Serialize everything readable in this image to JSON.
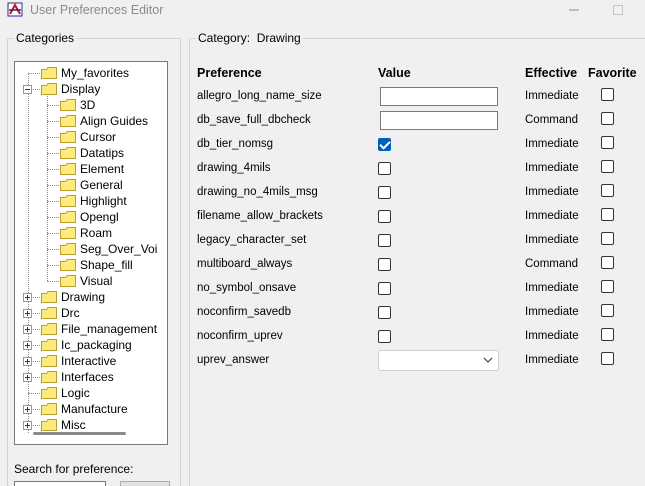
{
  "window": {
    "title": "User Preferences Editor"
  },
  "categories_panel": {
    "legend": "Categories",
    "tree": [
      {
        "label": "My_favorites",
        "depth": 0,
        "expander": "none"
      },
      {
        "label": "Display",
        "depth": 0,
        "expander": "minus"
      },
      {
        "label": "3D",
        "depth": 1,
        "expander": "none"
      },
      {
        "label": "Align Guides",
        "depth": 1,
        "expander": "none"
      },
      {
        "label": "Cursor",
        "depth": 1,
        "expander": "none"
      },
      {
        "label": "Datatips",
        "depth": 1,
        "expander": "none"
      },
      {
        "label": "Element",
        "depth": 1,
        "expander": "none"
      },
      {
        "label": "General",
        "depth": 1,
        "expander": "none"
      },
      {
        "label": "Highlight",
        "depth": 1,
        "expander": "none"
      },
      {
        "label": "Opengl",
        "depth": 1,
        "expander": "none"
      },
      {
        "label": "Roam",
        "depth": 1,
        "expander": "none"
      },
      {
        "label": "Seg_Over_Voi",
        "depth": 1,
        "expander": "none"
      },
      {
        "label": "Shape_fill",
        "depth": 1,
        "expander": "none"
      },
      {
        "label": "Visual",
        "depth": 1,
        "expander": "none"
      },
      {
        "label": "Drawing",
        "depth": 0,
        "expander": "plus"
      },
      {
        "label": "Drc",
        "depth": 0,
        "expander": "plus"
      },
      {
        "label": "File_management",
        "depth": 0,
        "expander": "plus"
      },
      {
        "label": "Ic_packaging",
        "depth": 0,
        "expander": "plus"
      },
      {
        "label": "Interactive",
        "depth": 0,
        "expander": "plus"
      },
      {
        "label": "Interfaces",
        "depth": 0,
        "expander": "plus"
      },
      {
        "label": "Logic",
        "depth": 0,
        "expander": "none"
      },
      {
        "label": "Manufacture",
        "depth": 0,
        "expander": "plus"
      },
      {
        "label": "Misc",
        "depth": 0,
        "expander": "plus"
      }
    ],
    "search_label": "Search for preference:"
  },
  "category_panel": {
    "legend_label": "Category:",
    "legend_value": "Drawing",
    "headers": {
      "preference": "Preference",
      "value": "Value",
      "effective": "Effective",
      "favorite": "Favorite"
    },
    "rows": [
      {
        "name": "allegro_long_name_size",
        "control": "text",
        "value": "",
        "effective": "Immediate",
        "favorite": false
      },
      {
        "name": "db_save_full_dbcheck",
        "control": "text",
        "value": "",
        "effective": "Command",
        "favorite": false
      },
      {
        "name": "db_tier_nomsg",
        "control": "checkbox",
        "checked": true,
        "effective": "Immediate",
        "favorite": false
      },
      {
        "name": "drawing_4mils",
        "control": "checkbox",
        "checked": false,
        "effective": "Immediate",
        "favorite": false
      },
      {
        "name": "drawing_no_4mils_msg",
        "control": "checkbox",
        "checked": false,
        "effective": "Immediate",
        "favorite": false
      },
      {
        "name": "filename_allow_brackets",
        "control": "checkbox",
        "checked": false,
        "effective": "Immediate",
        "favorite": false
      },
      {
        "name": "legacy_character_set",
        "control": "checkbox",
        "checked": false,
        "effective": "Immediate",
        "favorite": false
      },
      {
        "name": "multiboard_always",
        "control": "checkbox",
        "checked": false,
        "effective": "Command",
        "favorite": false
      },
      {
        "name": "no_symbol_onsave",
        "control": "checkbox",
        "checked": false,
        "effective": "Immediate",
        "favorite": false
      },
      {
        "name": "noconfirm_savedb",
        "control": "checkbox",
        "checked": false,
        "effective": "Immediate",
        "favorite": false
      },
      {
        "name": "noconfirm_uprev",
        "control": "checkbox",
        "checked": false,
        "effective": "Immediate",
        "favorite": false
      },
      {
        "name": "uprev_answer",
        "control": "combo",
        "value": "",
        "effective": "Immediate",
        "favorite": false
      }
    ]
  },
  "colors": {
    "accent": "#005fb8",
    "folder": "#ffe97a",
    "folder_edge": "#b8a030"
  },
  "icons": {
    "app": "app-icon",
    "minimize": "minimize-icon",
    "maximize": "maximize-icon",
    "folder": "folder-icon",
    "dropdown": "chevron-down-icon"
  }
}
